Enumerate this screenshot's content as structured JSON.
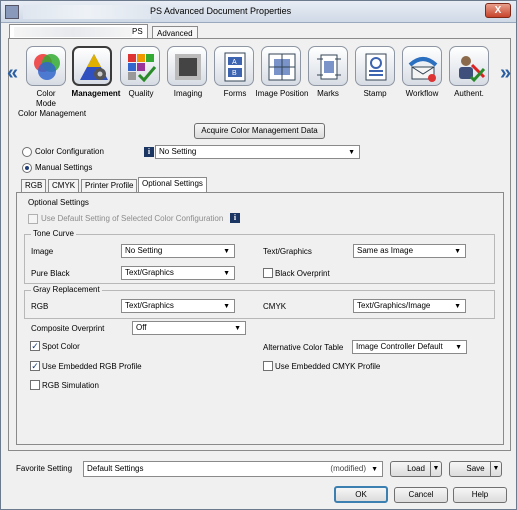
{
  "window": {
    "title": "PS Advanced Document Properties",
    "close": "X"
  },
  "tabs": {
    "t1": "PS",
    "t2": "Advanced"
  },
  "nav": {
    "left_arrow": "«",
    "right_arrow": "»",
    "items": [
      "Color Mode",
      "Management",
      "Quality",
      "Imaging",
      "Forms",
      "Image Position",
      "Marks",
      "Stamp",
      "Workflow",
      "Authent."
    ]
  },
  "colormgmt": {
    "heading": "Color Management",
    "acquire": "Acquire Color Management Data",
    "color_configuration": "Color Configuration",
    "config_value": "No Setting",
    "manual_settings": "Manual Settings",
    "info_glyph": "i"
  },
  "subtabs": [
    "RGB",
    "CMYK",
    "Printer Profile",
    "Optional Settings"
  ],
  "optional": {
    "heading": "Optional Settings",
    "use_default": "Use Default Setting of Selected Color Configuration",
    "tone_curve": "Tone Curve",
    "image": "Image",
    "image_value": "No Setting",
    "text_graphics": "Text/Graphics",
    "text_graphics_value": "Same as Image",
    "pure_black": "Pure Black",
    "pure_black_value": "Text/Graphics",
    "black_overprint": "Black Overprint",
    "gray_replacement": "Gray Replacement",
    "rgb": "RGB",
    "rgb_value": "Text/Graphics",
    "cmyk": "CMYK",
    "cmyk_value": "Text/Graphics/Image",
    "composite_overprint": "Composite Overprint",
    "composite_overprint_value": "Off",
    "spot_color": "Spot Color",
    "alt_color_table": "Alternative Color Table",
    "alt_color_table_value": "Image Controller Default",
    "use_embedded_rgb": "Use Embedded RGB Profile",
    "use_embedded_cmyk": "Use Embedded CMYK Profile",
    "rgb_simulation": "RGB Simulation",
    "check_glyph": "✓"
  },
  "footer": {
    "favorite_setting": "Favorite Setting",
    "favorite_value": "Default Settings",
    "modified": "(modified)",
    "load": "Load",
    "save": "Save",
    "ok": "OK",
    "cancel": "Cancel",
    "help": "Help"
  }
}
